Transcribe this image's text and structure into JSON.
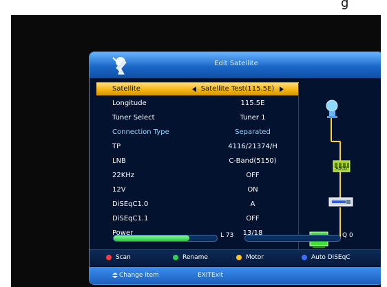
{
  "top_text": "g",
  "header": {
    "title": "Edit Satellite"
  },
  "rows": [
    {
      "label": "Satellite",
      "value": "Satellite Test(115.5E)"
    },
    {
      "label": "Longitude",
      "value": "115.5E"
    },
    {
      "label": "Tuner Select",
      "value": "Tuner 1"
    },
    {
      "label": "Connection Type",
      "value": "Separated"
    },
    {
      "label": "TP",
      "value": "4116/21374/H"
    },
    {
      "label": "LNB",
      "value": "C-Band(5150)"
    },
    {
      "label": "22KHz",
      "value": "OFF"
    },
    {
      "label": "12V",
      "value": "ON"
    },
    {
      "label": "DiSEqC1.0",
      "value": "A"
    },
    {
      "label": "DiSEqC1.1",
      "value": "OFF"
    },
    {
      "label": "Power",
      "value": "13/18"
    }
  ],
  "signal": {
    "level_text": "L 73",
    "level_value": 73,
    "quality_text": "Q 0",
    "quality_value": 0
  },
  "footer": {
    "keys": [
      {
        "label": "Scan",
        "color": "#ff3b3b"
      },
      {
        "label": "Rename",
        "color": "#2fcf58"
      },
      {
        "label": "Motor",
        "color": "#ffc21f"
      },
      {
        "label": "Auto DiSEqC",
        "color": "#3e6dff"
      }
    ],
    "nav_left": "Change Item",
    "nav_right": "EXITExit"
  },
  "diagram": {
    "switch_label": "ABCD",
    "icons": [
      "satellite-dish-icon",
      "diseqc-switch-icon",
      "lnb-cable-icon",
      "tv-icon"
    ]
  }
}
